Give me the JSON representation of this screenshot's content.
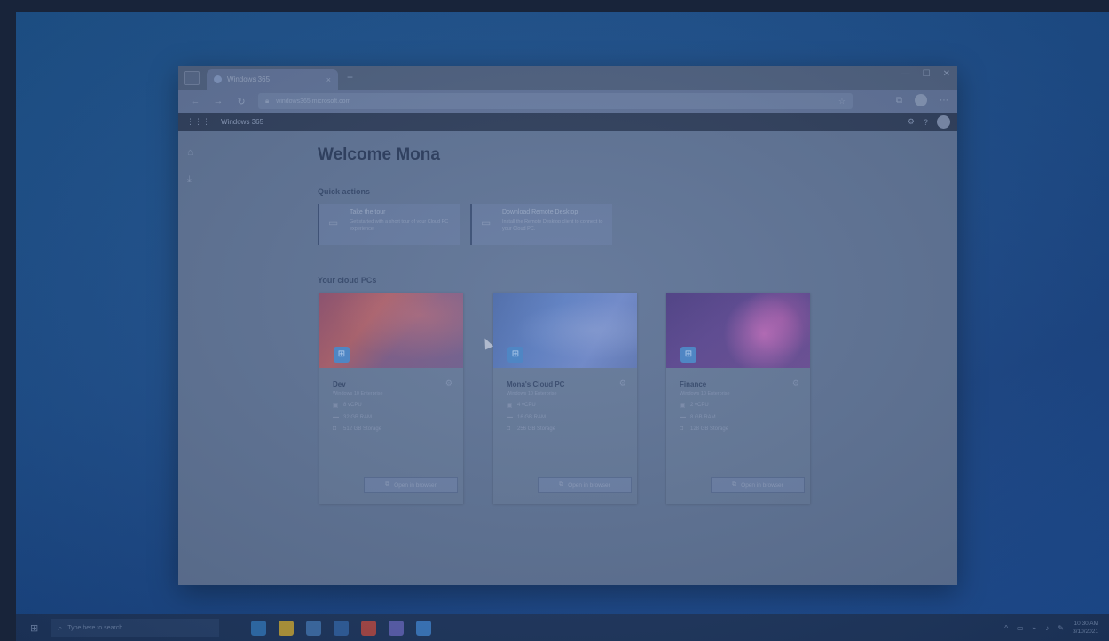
{
  "browser": {
    "tab_title": "Windows 365",
    "tab_close": "×",
    "new_tab": "+",
    "win_minimize": "—",
    "win_maximize": "☐",
    "win_close": "✕",
    "back": "←",
    "forward": "→",
    "refresh": "↻",
    "url": "windows365.microsoft.com",
    "favorite": "☆",
    "collections": "⧉",
    "more": "⋯"
  },
  "app": {
    "waffle": "⋮⋮⋮",
    "name": "Windows 365",
    "settings": "⚙",
    "help": "?"
  },
  "main": {
    "welcome": "Welcome Mona",
    "quick_actions_title": "Quick actions",
    "quick_actions": [
      {
        "name": "Take the tour",
        "desc": "Get started with a short tour of your Cloud PC experience."
      },
      {
        "name": "Download Remote Desktop",
        "desc": "Install the Remote Desktop client to connect to your Cloud PC."
      }
    ],
    "your_pcs_title": "Your cloud PCs",
    "pcs": [
      {
        "name": "Dev",
        "sub": "Windows 10 Enterprise",
        "specs": [
          "8 vCPU",
          "32 GB RAM",
          "512 GB Storage"
        ],
        "open": "Open in browser",
        "more": "⚙"
      },
      {
        "name": "Mona's Cloud PC",
        "sub": "Windows 10 Enterprise",
        "specs": [
          "4 vCPU",
          "16 GB RAM",
          "256 GB Storage"
        ],
        "open": "Open in browser",
        "more": "⚙"
      },
      {
        "name": "Finance",
        "sub": "Windows 10 Enterprise",
        "specs": [
          "2 vCPU",
          "8 GB RAM",
          "128 GB Storage"
        ],
        "open": "Open in browser",
        "more": "⚙"
      }
    ]
  },
  "taskbar": {
    "start": "⊞",
    "search_placeholder": "Type here to search",
    "search_icon": "⌕",
    "apps": [
      {
        "name": "edge",
        "color": "#2f6fb0"
      },
      {
        "name": "file-explorer",
        "color": "#b59a3c"
      },
      {
        "name": "store",
        "color": "#3d6da8"
      },
      {
        "name": "outlook",
        "color": "#2f5f9f"
      },
      {
        "name": "office",
        "color": "#a84848"
      },
      {
        "name": "teams",
        "color": "#5a5fb0"
      },
      {
        "name": "remote-desktop",
        "color": "#3a78c0"
      }
    ],
    "time": "10:30 AM",
    "date": "3/10/2021",
    "tray_icons": [
      "^",
      "▭",
      "⌁",
      "♪",
      "✎"
    ]
  }
}
